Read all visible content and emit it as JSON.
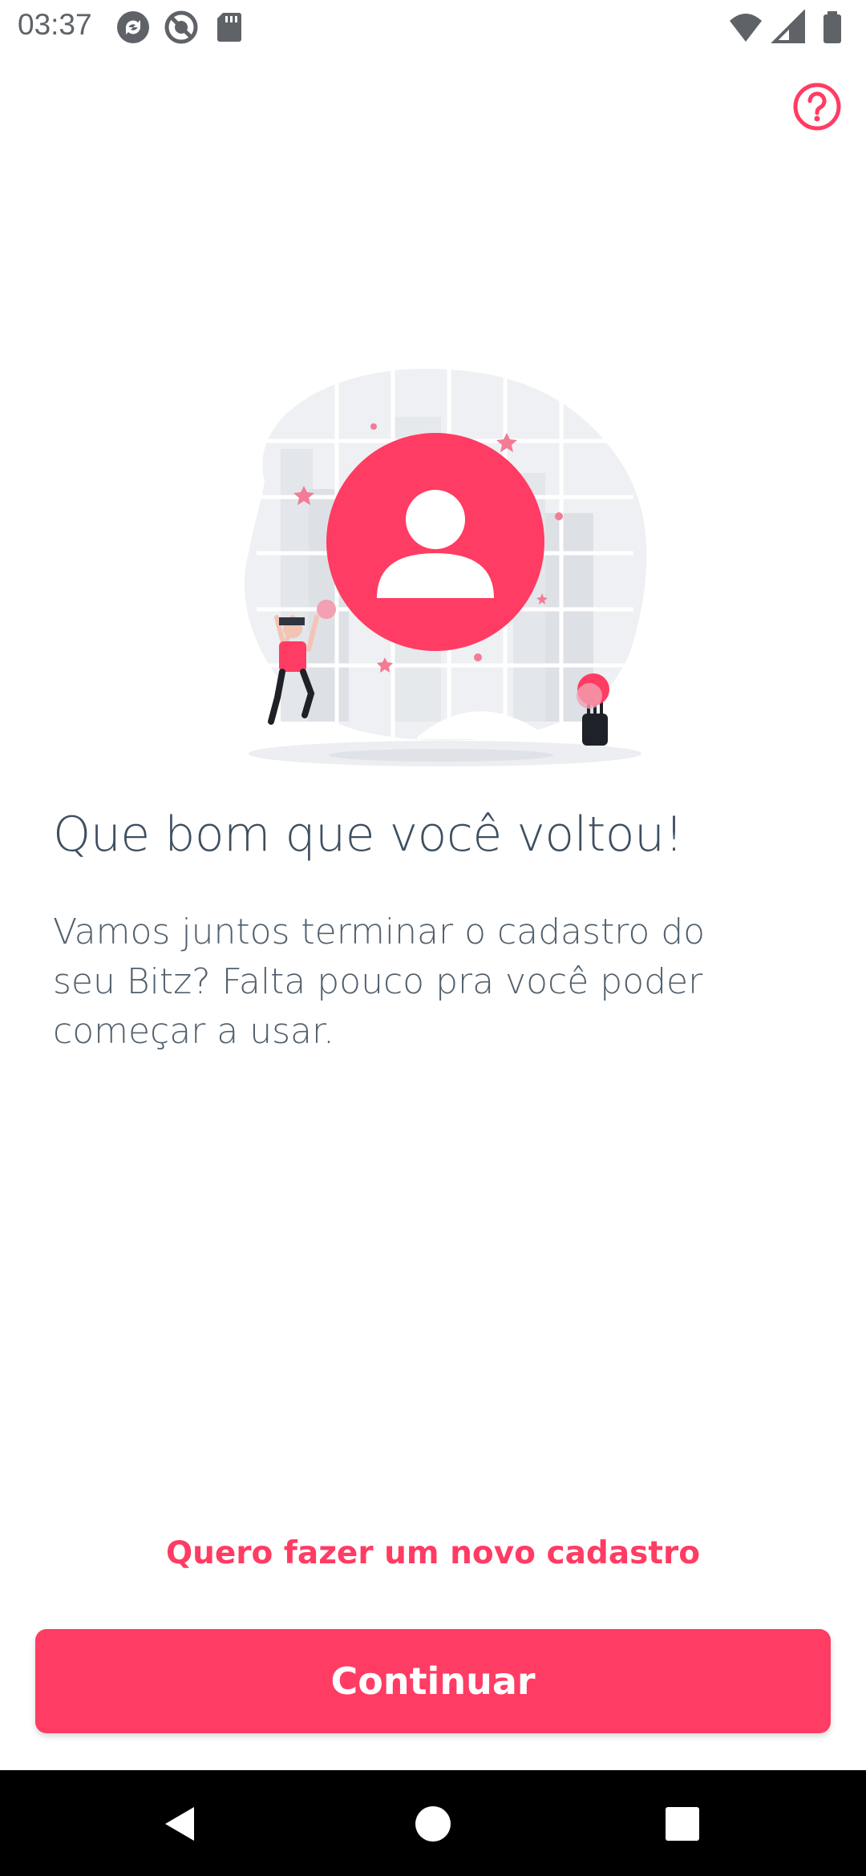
{
  "status_bar": {
    "time": "03:37",
    "left_icons": [
      "sync-icon",
      "blocked-icon",
      "sd-card-icon"
    ],
    "right_icons": [
      "wifi-icon",
      "signal-icon",
      "battery-icon"
    ]
  },
  "header": {
    "help_icon": "help-circle-icon"
  },
  "illustration": {
    "icon": "user-profile-illustration"
  },
  "content": {
    "title": "Que bom que você voltou!",
    "subtitle": "Vamos juntos terminar o cadastro do seu Bitz? Falta pouco pra você poder começar a usar."
  },
  "actions": {
    "new_signup_label": "Quero fazer um novo cadastro",
    "continue_label": "Continuar"
  },
  "nav_bar": {
    "buttons": [
      "back-icon",
      "home-icon",
      "recent-apps-icon"
    ]
  },
  "colors": {
    "accent": "#ff3c63",
    "title_text": "#3d4f60",
    "body_text": "#52606d",
    "illustration_bg": "#eceef1"
  }
}
